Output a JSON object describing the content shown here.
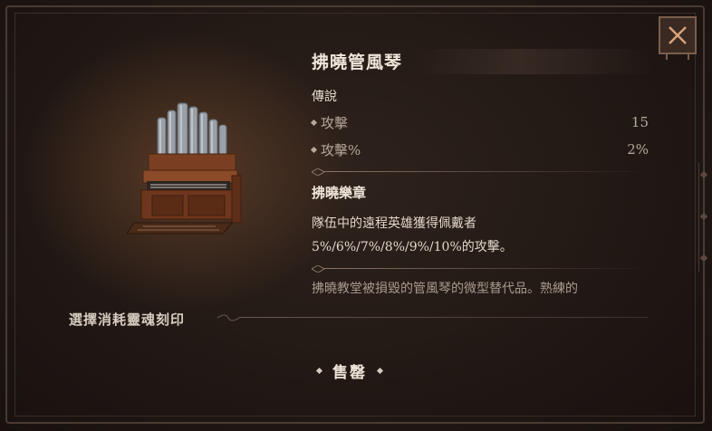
{
  "item": {
    "name": "拂曉管風琴",
    "rarity": "傳說",
    "stats": [
      {
        "name": "攻擊",
        "value": "15"
      },
      {
        "name": "攻擊%",
        "value": "2%"
      }
    ],
    "set_name": "拂曉樂章",
    "set_desc_line1": "隊伍中的遠程英雄獲得佩戴者",
    "set_desc_line2": "5%/6%/7%/8%/9%/10%的攻擊。",
    "lore": "拂曉教堂被損毀的管風琴的微型替代品。熟練的"
  },
  "soul_engrave_label": "選擇消耗靈魂刻印",
  "sell_label": "售罄",
  "icons": {
    "close": "close-x-icon",
    "item": "pipe-organ-icon"
  },
  "colors": {
    "panel_bg": "#1d1512",
    "accent_border": "#7a5f4d",
    "title_text": "#efe4d8",
    "stat_text": "#b8a99b"
  }
}
